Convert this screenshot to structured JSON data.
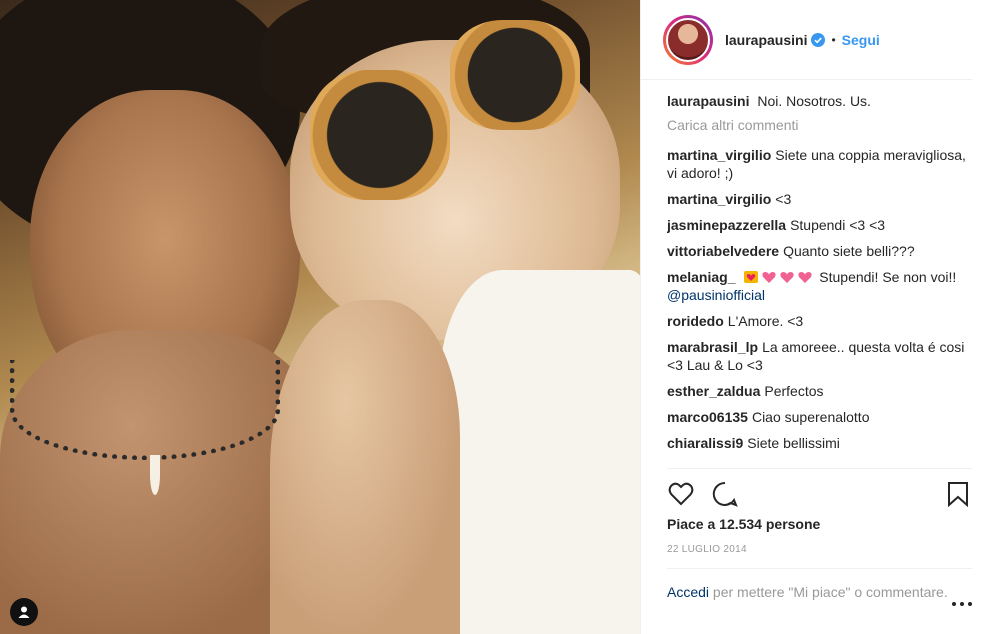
{
  "post": {
    "username": "laurapausini",
    "follow_label": "Segui",
    "separator": "•",
    "caption": {
      "user": "laurapausini",
      "text": "Noi. Nosotros. Us."
    },
    "load_more": "Carica altri commenti",
    "comments": [
      {
        "user": "martina_virgilio",
        "text": "Siete una coppia meravigliosa, vi adoro! ;)"
      },
      {
        "user": "martina_virgilio",
        "text": "<3"
      },
      {
        "user": "jasminepazzerella",
        "text": "Stupendi <3 <3"
      },
      {
        "user": "vittoriabelvedere",
        "text": "Quanto siete belli???"
      },
      {
        "user": "melaniag_",
        "text_after_emoji": " Stupendi! Se non voi!!",
        "mention": "@pausiniofficial"
      },
      {
        "user": "roridedo",
        "text": "L'Amore. <3"
      },
      {
        "user": "marabrasil_lp",
        "text": "La amoreee.. questa volta é cosi <3 Lau & Lo <3"
      },
      {
        "user": "esther_zaldua",
        "text": "Perfectos"
      },
      {
        "user": "marco06135",
        "text": "Ciao superenalotto"
      },
      {
        "user": "chiaralissi9",
        "text": "Siete bellissimi"
      }
    ],
    "likes": "Piace a 12.534 persone",
    "date": "22 LUGLIO 2014",
    "footer": {
      "login": "Accedi",
      "rest": " per mettere \"Mi piace\" o commentare."
    }
  },
  "icons": {
    "verified": "verified-badge-icon",
    "like": "heart-icon",
    "comment": "comment-bubble-icon",
    "save": "bookmark-icon",
    "more": "more-options-icon",
    "tag": "user-tag-icon"
  },
  "colors": {
    "accent": "#3897f0",
    "mention": "#003569",
    "muted": "#999999"
  }
}
